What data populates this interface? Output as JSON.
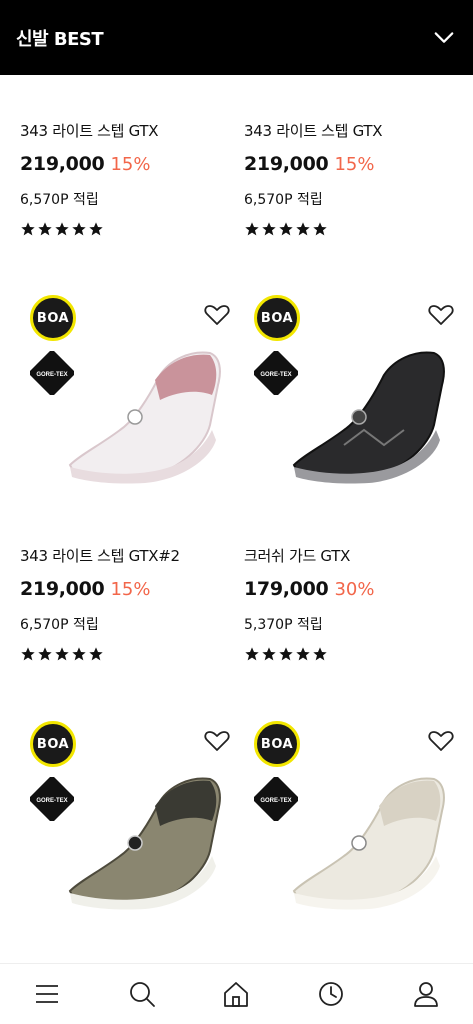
{
  "header": {
    "title": "신발 BEST"
  },
  "products": [
    {
      "name": "343 라이트 스텝 GTX",
      "price": "219,000",
      "discount": "15%",
      "point": "6,570P 적립",
      "rating": 5
    },
    {
      "name": "343 라이트 스텝 GTX",
      "price": "219,000",
      "discount": "15%",
      "point": "6,570P 적립",
      "rating": 5
    },
    {
      "name": "343 라이트 스텝 GTX#2",
      "price": "219,000",
      "discount": "15%",
      "point": "6,570P 적립",
      "rating": 5,
      "image": {
        "boa": "BOA",
        "gtx": "GORE-TEX",
        "color": "pink-white"
      }
    },
    {
      "name": "크러쉬 가드 GTX",
      "price": "179,000",
      "discount": "30%",
      "point": "5,370P 적립",
      "rating": 5,
      "image": {
        "boa": "BOA",
        "gtx": "GORE-TEX",
        "color": "black"
      }
    },
    {
      "image": {
        "boa": "BOA",
        "gtx": "GORE-TEX",
        "color": "khaki"
      }
    },
    {
      "image": {
        "boa": "BOA",
        "gtx": "GORE-TEX",
        "color": "ivory"
      }
    }
  ],
  "colors": {
    "header_bg": "#000000",
    "discount": "#f2664a",
    "boa_ring": "#f2e600"
  },
  "icons": {
    "header": "chevron-down-icon",
    "wishlist": "heart-icon",
    "nav": [
      "menu-icon",
      "search-icon",
      "home-icon",
      "recent-icon",
      "user-icon"
    ]
  }
}
